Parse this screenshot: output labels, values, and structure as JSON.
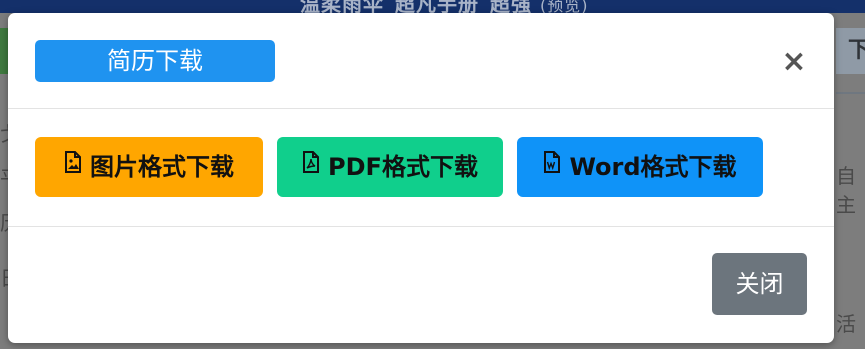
{
  "background": {
    "top_title": "温柔雨伞_超凡手册_超强",
    "top_suffix": "(预览)",
    "right_button_fragment": "下",
    "fragments": [
      "戈",
      "平",
      "历",
      "日"
    ],
    "right_fragments": [
      "自主",
      "活"
    ]
  },
  "modal": {
    "title": "简历下载",
    "close_symbol": "×",
    "download_buttons": [
      {
        "label": "图片格式下载",
        "icon": "file-image-icon",
        "color": "#ffa600"
      },
      {
        "label": "PDF格式下载",
        "icon": "file-pdf-icon",
        "color": "#10cf8c"
      },
      {
        "label": "Word格式下载",
        "icon": "file-word-icon",
        "color": "#0f93f8"
      }
    ],
    "footer_close_label": "关闭"
  },
  "colors": {
    "title_badge": "#1f93f0",
    "close_button": "#6c757d",
    "overlay": "#7d7d7d"
  }
}
